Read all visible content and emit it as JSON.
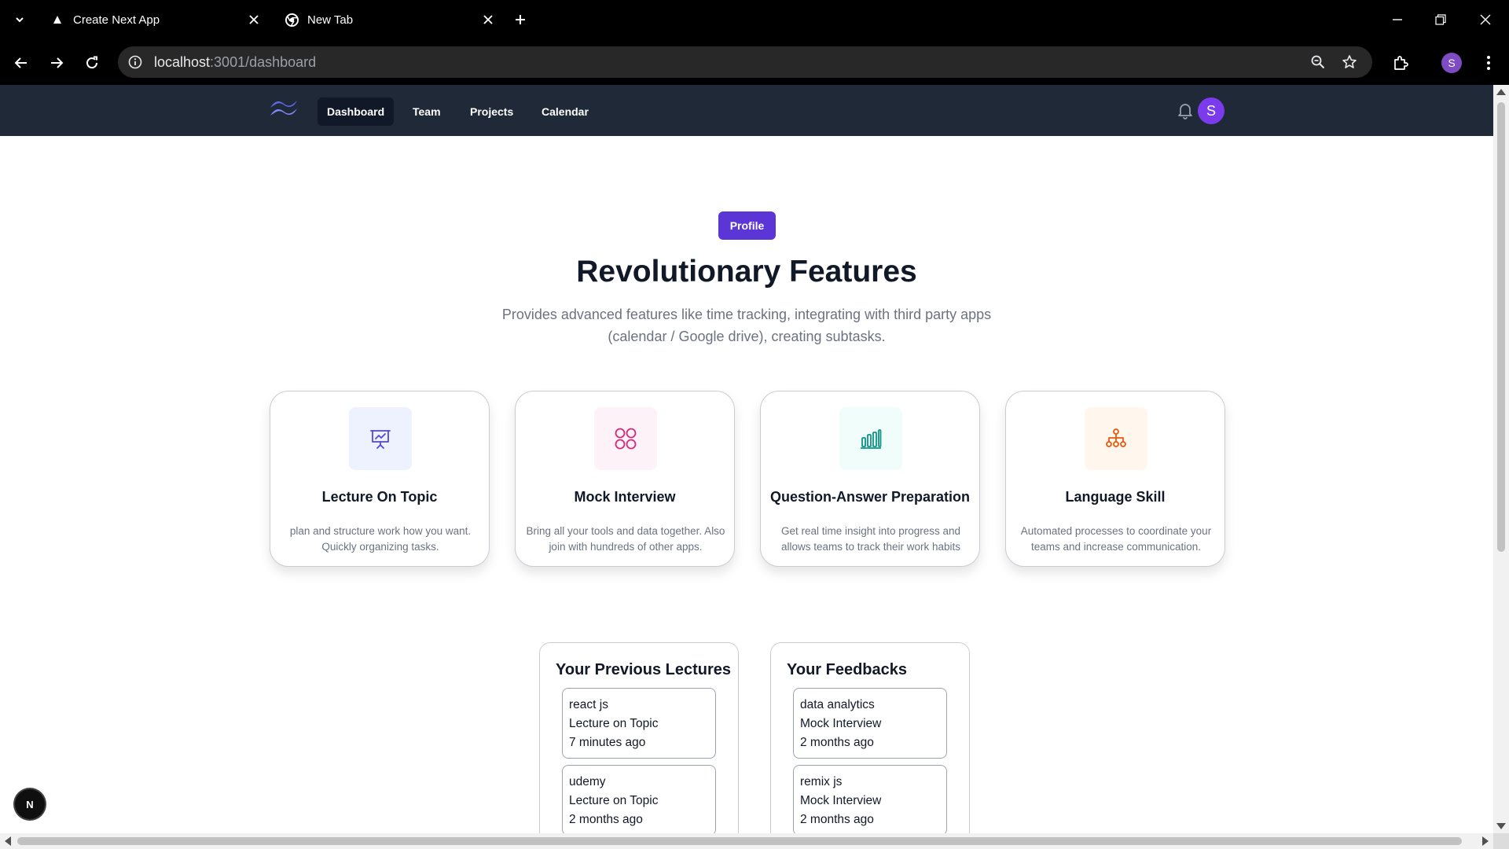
{
  "browser": {
    "tabs": [
      {
        "title": "Create Next App",
        "favicon": "triangle-icon",
        "active": true
      },
      {
        "title": "New Tab",
        "favicon": "chrome-icon",
        "active": false
      }
    ],
    "url_host": "localhost",
    "url_rest": ":3001/dashboard",
    "profile_initial": "S"
  },
  "app": {
    "nav": [
      "Dashboard",
      "Team",
      "Projects",
      "Calendar"
    ],
    "active_nav": "Dashboard",
    "user_initial": "S"
  },
  "hero": {
    "button": "Profile",
    "title": "Revolutionary Features",
    "subtitle": "Provides advanced features like time tracking, integrating with third party apps (calendar / Google drive), creating subtasks."
  },
  "features": [
    {
      "title": "Lecture On Topic",
      "desc": "plan and structure work how you want. Quickly organizing tasks.",
      "icon": "presentation-chart-icon",
      "icon_color": "#4f46e5",
      "bg": "#eef2ff"
    },
    {
      "title": "Mock Interview",
      "desc": "Bring all your tools and data together. Also join with hundreds of other apps.",
      "icon": "grid-circles-icon",
      "icon_color": "#db2777",
      "bg": "#fdf2f8"
    },
    {
      "title": "Question-Answer Preparation",
      "desc": "Get real time insight into progress and allows teams to track their work habits",
      "icon": "bar-chart-icon",
      "icon_color": "#0d9488",
      "bg": "#f0fdfa"
    },
    {
      "title": "Language Skill",
      "desc": "Automated processes to coordinate your teams and increase communication.",
      "icon": "hierarchy-icon",
      "icon_color": "#ea580c",
      "bg": "#fff7ed"
    }
  ],
  "lectures": {
    "title": "Your Previous Lectures",
    "items": [
      {
        "topic": "react js",
        "type": "Lecture on Topic",
        "time": "7 minutes ago"
      },
      {
        "topic": "udemy",
        "type": "Lecture on Topic",
        "time": "2 months ago"
      }
    ]
  },
  "feedbacks": {
    "title": "Your Feedbacks",
    "items": [
      {
        "topic": "data analytics",
        "type": "Mock Interview",
        "time": "2 months ago"
      },
      {
        "topic": "remix js",
        "type": "Mock Interview",
        "time": "2 months ago"
      }
    ]
  },
  "badge": "N"
}
